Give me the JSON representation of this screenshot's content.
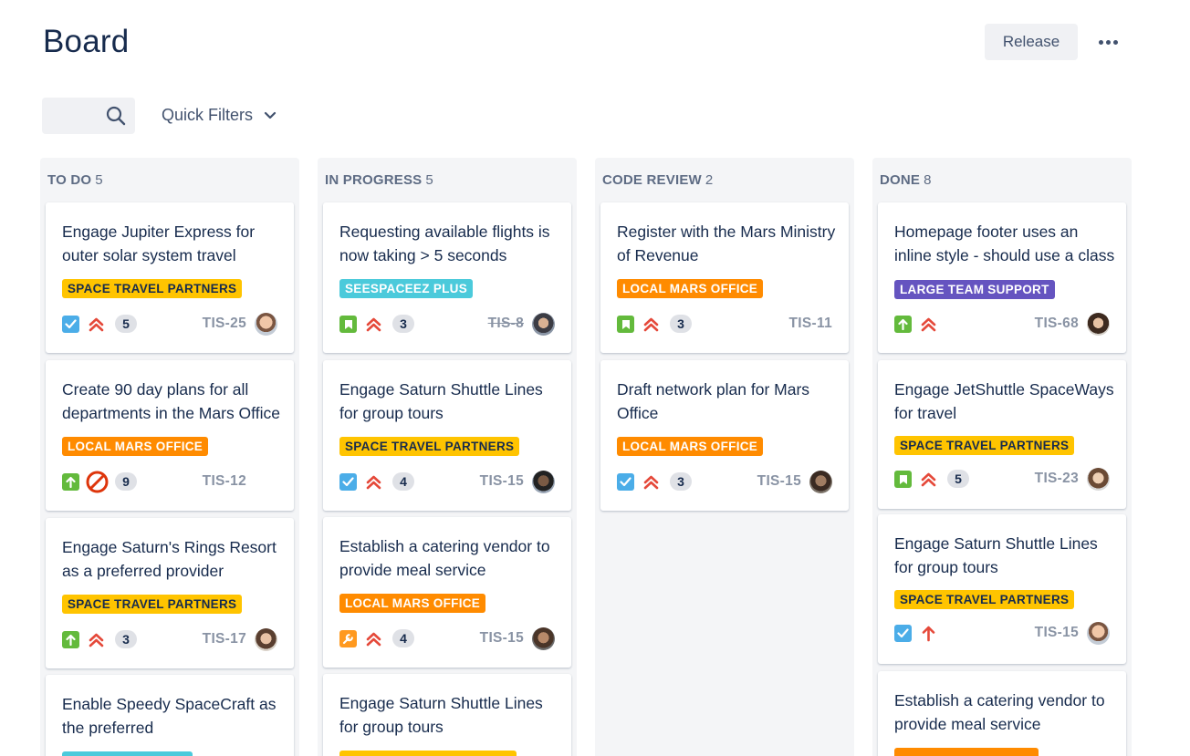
{
  "header": {
    "title": "Board",
    "release_label": "Release"
  },
  "toolbar": {
    "quick_filters_label": "Quick Filters"
  },
  "colors": {
    "task": "#4bade8",
    "story": "#63ba3c",
    "priority": "#e5493a",
    "yellow_label": "#ffc400",
    "orange_label": "#ff8b00",
    "teal_label": "#4bcadb",
    "purple_label": "#6554c0"
  },
  "columns": [
    {
      "name": "TO DO",
      "count": "5",
      "cards": [
        {
          "title": "Engage Jupiter Express for outer solar system travel",
          "label": "SPACE TRAVEL PARTNERS",
          "type_icon": "checkbox-task-icon",
          "priority_icon": "highest-priority-icon",
          "estimate": "5",
          "key": "TIS-25"
        },
        {
          "title": "Create 90 day plans for all departments in the Mars Office",
          "label": "LOCAL MARS OFFICE",
          "type_icon": "improvement-arrow-icon",
          "priority_icon": "blocker-icon",
          "estimate": "9",
          "key": "TIS-12"
        },
        {
          "title": "Engage Saturn's Rings Resort as a preferred provider",
          "label": "SPACE TRAVEL PARTNERS",
          "type_icon": "improvement-arrow-icon",
          "priority_icon": "highest-priority-icon",
          "estimate": "3",
          "key": "TIS-17"
        },
        {
          "title": "Enable Speedy SpaceCraft as the preferred",
          "label": "",
          "type_icon": "",
          "priority_icon": "",
          "estimate": "",
          "key": ""
        }
      ]
    },
    {
      "name": "IN PROGRESS",
      "count": "5",
      "cards": [
        {
          "title": "Requesting available flights is now taking > 5 seconds",
          "label": "SEESPACEEZ PLUS",
          "type_icon": "story-bookmark-icon",
          "priority_icon": "highest-priority-icon",
          "estimate": "3",
          "key": "TIS-8"
        },
        {
          "title": "Engage Saturn Shuttle Lines for group tours",
          "label": "SPACE TRAVEL PARTNERS",
          "type_icon": "checkbox-task-icon",
          "priority_icon": "highest-priority-icon",
          "estimate": "4",
          "key": "TIS-15"
        },
        {
          "title": "Establish a catering vendor to provide meal service",
          "label": "LOCAL MARS OFFICE",
          "type_icon": "wrench-icon",
          "priority_icon": "highest-priority-icon",
          "estimate": "4",
          "key": "TIS-15"
        },
        {
          "title": "Engage Saturn Shuttle Lines for group tours",
          "label": "",
          "type_icon": "",
          "priority_icon": "",
          "estimate": "",
          "key": ""
        }
      ]
    },
    {
      "name": "CODE REVIEW",
      "count": "2",
      "cards": [
        {
          "title": "Register with the Mars Ministry of Revenue",
          "label": "LOCAL MARS OFFICE",
          "type_icon": "story-bookmark-icon",
          "priority_icon": "highest-priority-icon",
          "estimate": "3",
          "key": "TIS-11"
        },
        {
          "title": "Draft network plan for Mars Office",
          "label": "LOCAL MARS OFFICE",
          "type_icon": "checkbox-task-icon",
          "priority_icon": "highest-priority-icon",
          "estimate": "3",
          "key": "TIS-15"
        }
      ]
    },
    {
      "name": "DONE",
      "count": "8",
      "cards": [
        {
          "title": "Homepage footer uses an inline style - should use a class",
          "label": "LARGE TEAM SUPPORT",
          "type_icon": "improvement-arrow-icon",
          "priority_icon": "highest-priority-icon",
          "estimate": "",
          "key": "TIS-68"
        },
        {
          "title": "Engage JetShuttle SpaceWays for travel",
          "label": "SPACE TRAVEL PARTNERS",
          "type_icon": "story-bookmark-icon",
          "priority_icon": "highest-priority-icon",
          "estimate": "5",
          "key": "TIS-23"
        },
        {
          "title": "Engage Saturn Shuttle Lines for group tours",
          "label": "SPACE TRAVEL PARTNERS",
          "type_icon": "checkbox-task-icon",
          "priority_icon": "high-priority-icon",
          "estimate": "",
          "key": "TIS-15"
        },
        {
          "title": "Establish a catering vendor to provide meal service",
          "label": "",
          "type_icon": "",
          "priority_icon": "",
          "estimate": "",
          "key": ""
        }
      ]
    }
  ]
}
